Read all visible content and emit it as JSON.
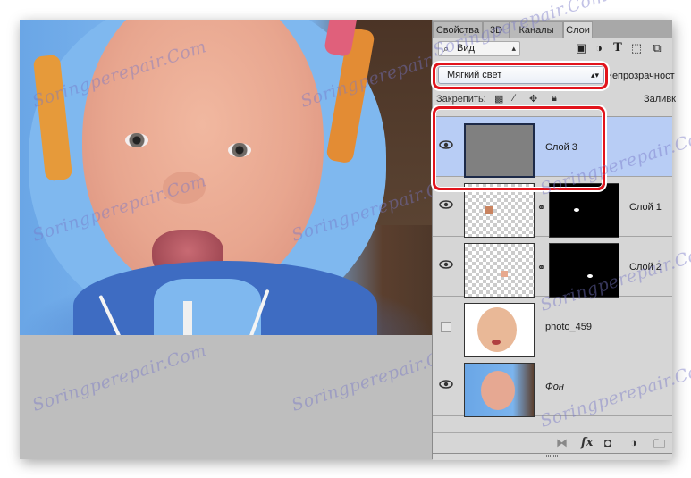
{
  "panel": {
    "tabs": [
      {
        "label": "Свойства",
        "active": false
      },
      {
        "label": "3D",
        "active": false
      },
      {
        "label": "Каналы",
        "active": false
      },
      {
        "label": "Слои",
        "active": true
      }
    ],
    "filter": {
      "label": "Вид",
      "icon": "search-icon"
    },
    "filter_icons": [
      "image-filter-icon",
      "adjustment-filter-icon",
      "type-filter-icon",
      "shape-filter-icon",
      "smart-object-filter-icon"
    ],
    "blend_mode": "Мягкий свет",
    "opacity_label": "Непрозрачност",
    "lock_label": "Закрепить:",
    "fill_label": "Заливк",
    "layers": [
      {
        "name": "Слой 3",
        "visible": true,
        "selected": true,
        "thumb": "gray-fill",
        "has_mask": false,
        "highlighted": true
      },
      {
        "name": "Слой 1",
        "visible": true,
        "selected": false,
        "thumb": "transparent-eye-patch",
        "has_mask": true
      },
      {
        "name": "Слой 2",
        "visible": true,
        "selected": false,
        "thumb": "transparent-eye-patch",
        "has_mask": true
      },
      {
        "name": "photo_459",
        "visible": false,
        "selected": false,
        "thumb": "baby-photo",
        "has_mask": false
      },
      {
        "name": "Фон",
        "visible": true,
        "selected": false,
        "thumb": "background-photo",
        "has_mask": false,
        "italic": true
      }
    ],
    "footer_icons": [
      "link-layers-icon",
      "fx-icon",
      "add-mask-icon",
      "adjustment-layer-icon",
      "new-group-icon"
    ]
  },
  "colors": {
    "highlight": "#e2141c",
    "selected_row": "#b8cdf5",
    "layer3_fill": "#808080"
  },
  "watermark": "Soringperepair.Com"
}
